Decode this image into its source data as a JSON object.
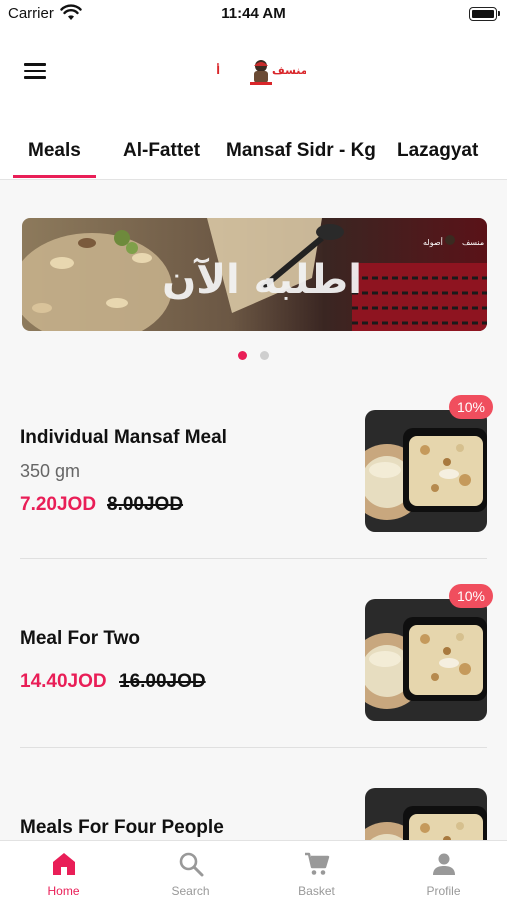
{
  "status_bar": {
    "carrier": "Carrier",
    "time": "11:44 AM"
  },
  "header": {
    "logo_text": "منسف ع أصوله"
  },
  "tabs": [
    {
      "label": "Meals",
      "active": true
    },
    {
      "label": "Al-Fattet",
      "active": false
    },
    {
      "label": "Mansaf Sidr - Kg",
      "active": false
    },
    {
      "label": "Lazagyat",
      "active": false
    }
  ],
  "banner": {
    "text": "اطلبه الآن",
    "logo_text": "منسف ع أصوله",
    "slide_count": 2,
    "active_slide": 1
  },
  "meals": [
    {
      "name": "Individual Mansaf Meal",
      "weight": "350 gm",
      "price": "7.20JOD",
      "old_price": "8.00JOD",
      "discount": "10%"
    },
    {
      "name": "Meal For Two",
      "weight": "",
      "price": "14.40JOD",
      "old_price": "16.00JOD",
      "discount": "10%"
    },
    {
      "name": "Meals For Four People",
      "weight": "",
      "price": "",
      "old_price": "",
      "discount": ""
    }
  ],
  "bottom_nav": [
    {
      "label": "Home",
      "icon": "home-icon",
      "active": true
    },
    {
      "label": "Search",
      "icon": "search-icon",
      "active": false
    },
    {
      "label": "Basket",
      "icon": "cart-icon",
      "active": false
    },
    {
      "label": "Profile",
      "icon": "profile-icon",
      "active": false
    }
  ],
  "colors": {
    "accent": "#e91e57",
    "badge": "#f04e5e",
    "inactive_nav": "#999999"
  }
}
